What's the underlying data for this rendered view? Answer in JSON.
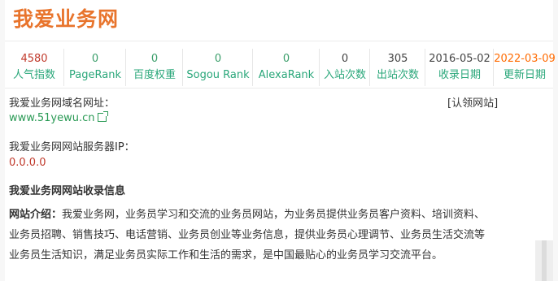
{
  "site": {
    "title": "我爱业务网"
  },
  "stats": [
    {
      "value": "4580",
      "label": "人气指数",
      "color": "#c0392b"
    },
    {
      "value": "0",
      "label": "PageRank",
      "color": "#3a9e6a"
    },
    {
      "value": "0",
      "label": "百度权重",
      "color": "#3a9e6a"
    },
    {
      "value": "0",
      "label": "Sogou Rank",
      "color": "#3a9e6a"
    },
    {
      "value": "0",
      "label": "AlexaRank",
      "color": "#3a9e6a"
    },
    {
      "value": "0",
      "label": "入站次数",
      "color": "#444444"
    },
    {
      "value": "305",
      "label": "出站次数",
      "color": "#444444"
    },
    {
      "value": "2016-05-02",
      "label": "收录日期",
      "color": "#444444"
    },
    {
      "value": "2022-03-09",
      "label": "更新日期",
      "color": "#ff6a00"
    }
  ],
  "details": {
    "domain_label": "我爱业务网域名网址：",
    "claim_label": "[认领网站]",
    "domain_url": "www.51yewu.cn",
    "ip_label": "我爱业务网网站服务器IP：",
    "ip_value": "0.0.0.0",
    "section_title": "我爱业务网网站收录信息",
    "intro_label": "网站介绍：",
    "intro_text": "我爱业务网，业务员学习和交流的业务员网站，为业务员提供业务员客户资料、培训资料、业务员招聘、销售技巧、电话营销、业务员创业等业务信息，提供业务员心理调节、业务员生活交流等业务员生活知识，满足业务员实际工作和生活的需求，是中国最贴心的业务员学习交流平台。"
  }
}
